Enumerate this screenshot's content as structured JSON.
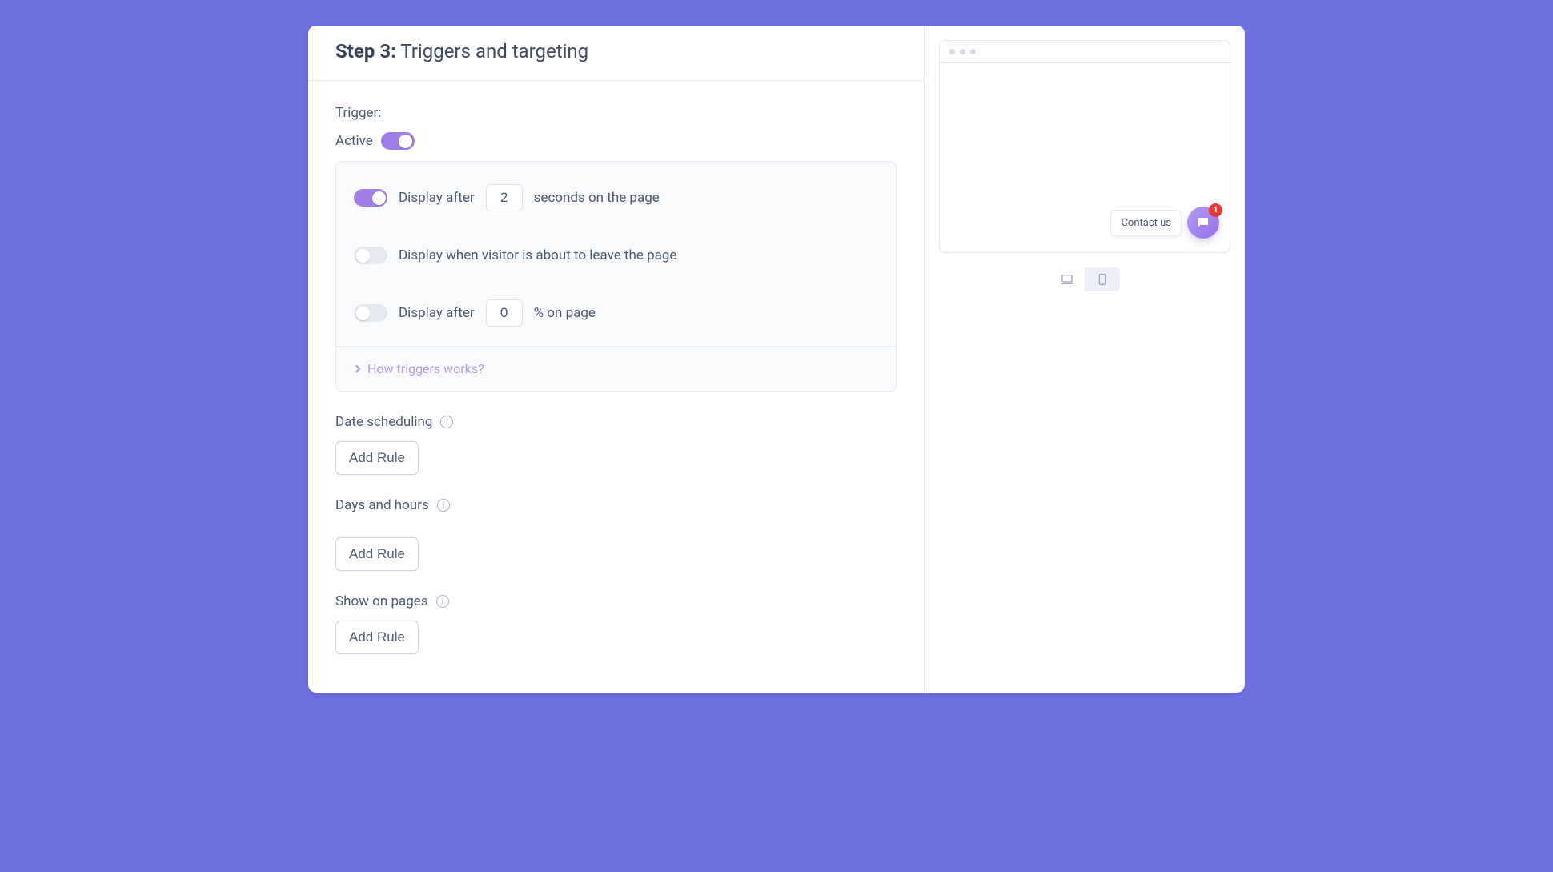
{
  "header": {
    "step_prefix": "Step 3:",
    "title": "Triggers and targeting"
  },
  "trigger": {
    "label": "Trigger:",
    "active_label": "Active",
    "active_on": true,
    "rows": {
      "after_seconds": {
        "on": true,
        "pre": "Display after",
        "value": "2",
        "post": "seconds on the page"
      },
      "exit_intent": {
        "on": false,
        "text": "Display when visitor is about to leave the page"
      },
      "after_scroll": {
        "on": false,
        "pre": "Display after",
        "value": "0",
        "post": "% on page"
      }
    },
    "help_link": "How triggers works?"
  },
  "sections": {
    "date": {
      "title": "Date scheduling",
      "button": "Add Rule"
    },
    "days": {
      "title": "Days and hours",
      "button": "Add Rule"
    },
    "pages": {
      "title": "Show on pages",
      "button": "Add Rule"
    }
  },
  "preview": {
    "contact_label": "Contact us",
    "badge_count": "1"
  }
}
